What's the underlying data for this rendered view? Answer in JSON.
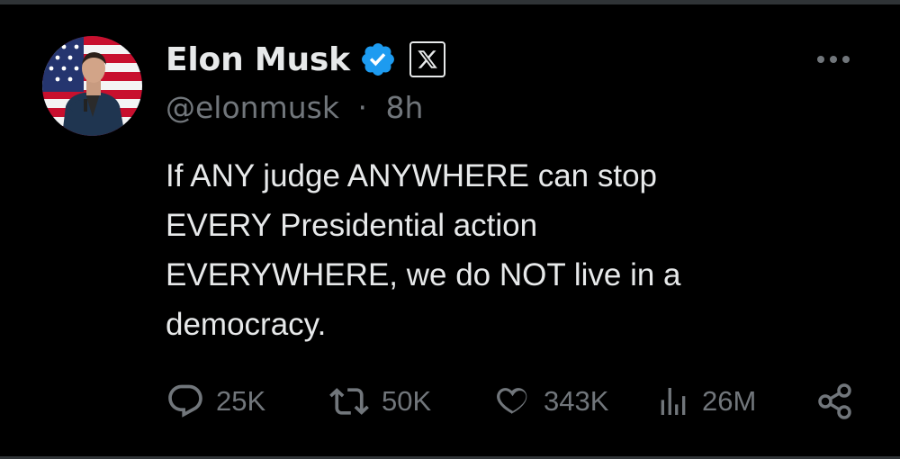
{
  "tweet": {
    "author": {
      "display_name": "Elon Musk",
      "handle": "@elonmusk",
      "verified_icon": "verified-badge-icon",
      "affiliation_icon": "x-logo-icon"
    },
    "meta": {
      "separator": "·",
      "time": "8h"
    },
    "text_lines": [
      "If ANY judge ANYWHERE can stop",
      "EVERY Presidential action",
      "EVERYWHERE, we do NOT live in a",
      "democracy."
    ],
    "actions": {
      "replies": "25K",
      "reposts": "50K",
      "likes": "343K",
      "views": "26M"
    }
  },
  "colors": {
    "background": "#000000",
    "text": "#e7e9ea",
    "secondary": "#71767b",
    "verified": "#1d9bf0"
  }
}
